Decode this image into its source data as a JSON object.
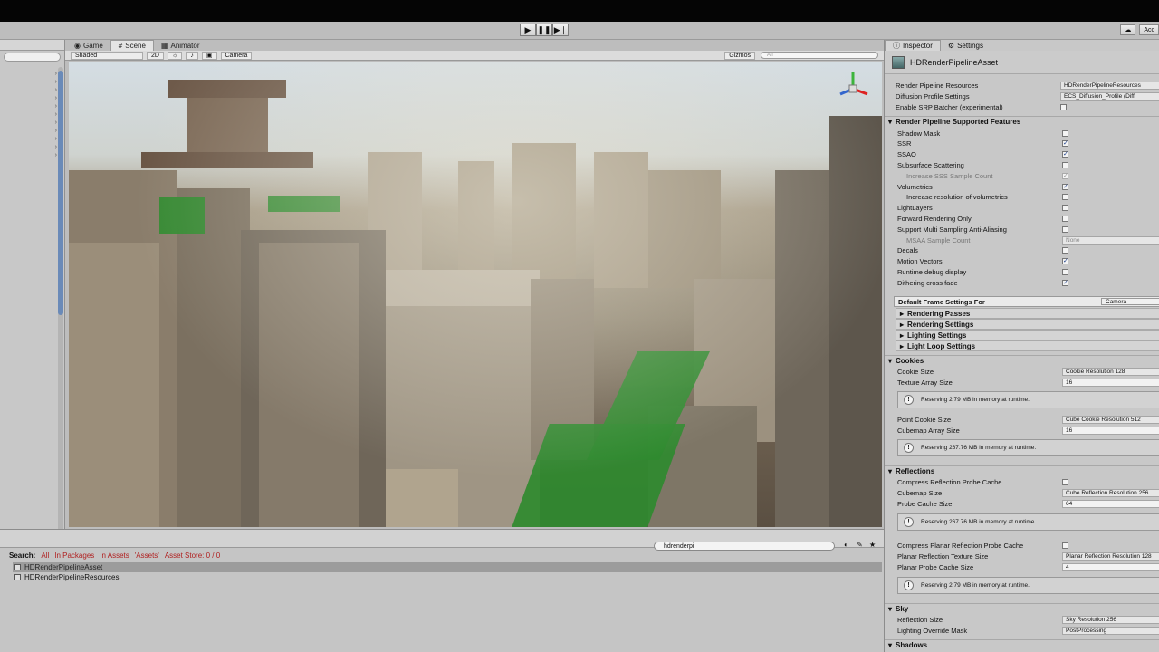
{
  "toolbar": {
    "account_label": "Acc"
  },
  "scene": {
    "tabs": [
      {
        "label": "Game",
        "icon": "gamepad-icon"
      },
      {
        "label": "Scene",
        "icon": "scene-icon"
      },
      {
        "label": "Animator",
        "icon": "animator-icon"
      }
    ],
    "shading_mode": "Shaded",
    "mode_2d": "2D",
    "camera_label": "Camera",
    "gizmos_label": "Gizmos",
    "search_placeholder": "All"
  },
  "project": {
    "search_value": "hdrenderpi",
    "search_label": "Search:",
    "filters": {
      "all": "All",
      "in_packages": "In Packages",
      "in_assets": "In Assets",
      "assets_quoted": "'Assets'",
      "asset_store": "Asset Store: 0 / 0"
    },
    "files": [
      "HDRenderPipelineAsset",
      "HDRenderPipelineResources"
    ]
  },
  "inspector": {
    "tabs": [
      "Inspector",
      "Settings"
    ],
    "asset_name": "HDRenderPipelineAsset",
    "top_fields": [
      {
        "label": "Render Pipeline Resources",
        "value": "HDRenderPipelineResources"
      },
      {
        "label": "Diffusion Profile Settings",
        "value": "ECS_Diffusion_Profile (Diff"
      }
    ],
    "srp_batcher_label": "Enable SRP Batcher (experimental)",
    "features_title": "Render Pipeline Supported Features",
    "features": [
      {
        "label": "Shadow Mask",
        "checked": false
      },
      {
        "label": "SSR",
        "checked": true
      },
      {
        "label": "SSAO",
        "checked": true
      },
      {
        "label": "Subsurface Scattering",
        "checked": false
      },
      {
        "label": "Increase SSS Sample Count",
        "checked": true,
        "indent": true,
        "dim": true
      },
      {
        "label": "Volumetrics",
        "checked": true
      },
      {
        "label": "Increase resolution of volumetrics",
        "checked": false,
        "indent": true
      },
      {
        "label": "LightLayers",
        "checked": false
      },
      {
        "label": "Forward Rendering Only",
        "checked": false
      },
      {
        "label": "Support Multi Sampling Anti-Aliasing",
        "checked": false
      },
      {
        "label": "MSAA Sample Count",
        "value": "None",
        "indent": true,
        "dim": true
      },
      {
        "label": "Decals",
        "checked": false
      },
      {
        "label": "Motion Vectors",
        "checked": true
      },
      {
        "label": "Runtime debug display",
        "checked": false
      },
      {
        "label": "Dithering cross fade",
        "checked": true
      }
    ],
    "frame_settings_label": "Default Frame Settings For",
    "frame_settings_value": "Camera",
    "foldouts": [
      "Rendering Passes",
      "Rendering Settings",
      "Lighting Settings",
      "Light Loop Settings"
    ],
    "cookies": {
      "title": "Cookies",
      "cookie_size_label": "Cookie Size",
      "cookie_size_value": "Cookie Resolution 128",
      "texture_array_label": "Texture Array Size",
      "texture_array_value": "16",
      "info1": "Reserving 2.79 MB in memory at runtime.",
      "point_cookie_label": "Point Cookie Size",
      "point_cookie_value": "Cube Cookie Resolution 512",
      "cubemap_array_label": "Cubemap Array Size",
      "cubemap_array_value": "16",
      "info2": "Reserving 267.76 MB in memory at runtime."
    },
    "reflections": {
      "title": "Reflections",
      "compress_probe_label": "Compress Reflection Probe Cache",
      "cubemap_size_label": "Cubemap Size",
      "cubemap_size_value": "Cube Reflection Resolution 256",
      "probe_cache_label": "Probe Cache Size",
      "probe_cache_value": "64",
      "info1": "Reserving 267.76 MB in memory at runtime.",
      "compress_planar_label": "Compress Planar Reflection Probe Cache",
      "planar_texture_label": "Planar Reflection Texture Size",
      "planar_texture_value": "Planar Reflection Resolution 128",
      "planar_cache_label": "Planar Probe Cache Size",
      "planar_cache_value": "4",
      "info2": "Reserving 2.79 MB in memory at runtime."
    },
    "sky": {
      "title": "Sky",
      "reflection_size_label": "Reflection Size",
      "reflection_size_value": "Sky Resolution 256",
      "lighting_override_label": "Lighting Override Mask",
      "lighting_override_value": "PostProcessing"
    },
    "shadows_title": "Shadows"
  }
}
